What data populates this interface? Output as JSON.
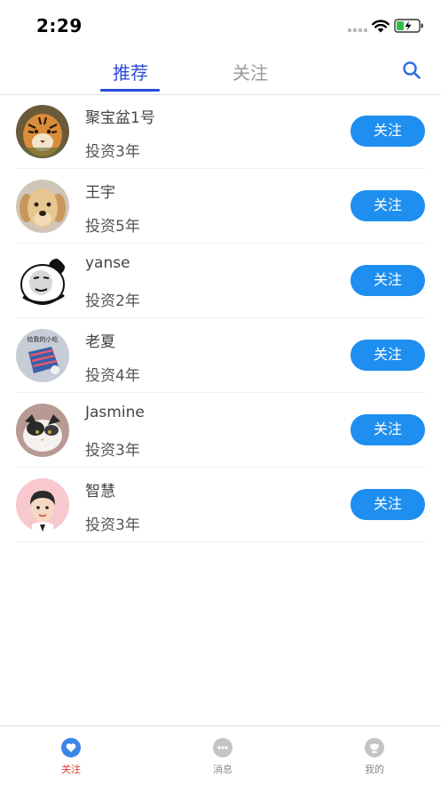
{
  "status_bar": {
    "time": "2:29"
  },
  "tabs": {
    "recommend_label": "推荐",
    "follow_label": "关注",
    "active": "recommend"
  },
  "users": [
    {
      "name": "聚宝盆1号",
      "years": "投资3年",
      "button": "关注",
      "avatar": "tiger-avatar"
    },
    {
      "name": "王宇",
      "years": "投资5年",
      "button": "关注",
      "avatar": "dog-avatar"
    },
    {
      "name": "yanse",
      "years": "投资2年",
      "button": "关注",
      "avatar": "panda-meme-avatar"
    },
    {
      "name": "老夏",
      "years": "投资4年",
      "button": "关注",
      "avatar": "illustration-avatar",
      "avatar_text": "给我的小吃"
    },
    {
      "name": "Jasmine",
      "years": "投资3年",
      "button": "关注",
      "avatar": "cat-avatar"
    },
    {
      "name": "智慧",
      "years": "投资3年",
      "button": "关注",
      "avatar": "cartoon-man-avatar"
    }
  ],
  "tabbar": [
    {
      "label": "关注",
      "icon": "heart-bubble-icon",
      "active": true
    },
    {
      "label": "消息",
      "icon": "chat-bubble-icon",
      "active": false
    },
    {
      "label": "我的",
      "icon": "profile-bubble-icon",
      "active": false
    }
  ],
  "colors": {
    "accent": "#2b4bd8",
    "button": "#1e8ff0",
    "tabbar_active": "#e0342b",
    "tabbar_icon_active": "#3a86e8",
    "tabbar_icon_inactive": "#c4c4c8"
  }
}
